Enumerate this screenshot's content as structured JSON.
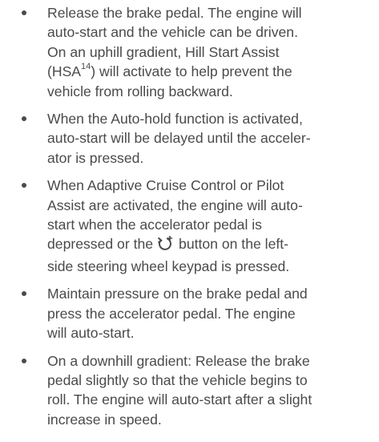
{
  "bullets": [
    {
      "lines": [
        "Release the brake pedal. The engine will",
        "auto-start and the vehicle can be driven.",
        "On an uphill gradient, Hill Start Assist"
      ],
      "line4_pre": "(HSA",
      "footnote": "14",
      "line4_post": ") will activate to help prevent the",
      "line5": "vehicle from rolling backward."
    },
    {
      "lines": [
        "When the Auto-hold function is activated,",
        "auto-start will be delayed until the acceler-",
        "ator is pressed."
      ]
    },
    {
      "lines": [
        "When Adaptive Cruise Control or Pilot",
        "Assist are activated, the engine will auto-",
        "start when the accelerator pedal is"
      ],
      "line4_pre": "depressed or the",
      "icon": "resume-button-icon",
      "line4_post": "button on the left-",
      "line5": "side steering wheel keypad is pressed."
    },
    {
      "lines": [
        "Maintain pressure on the brake pedal and",
        "press the accelerator pedal. The engine",
        "will auto-start."
      ]
    },
    {
      "lines": [
        "On a downhill gradient: Release the brake",
        "pedal slightly so that the vehicle begins to",
        "roll. The engine will auto-start after a slight",
        "increase in speed."
      ]
    }
  ]
}
